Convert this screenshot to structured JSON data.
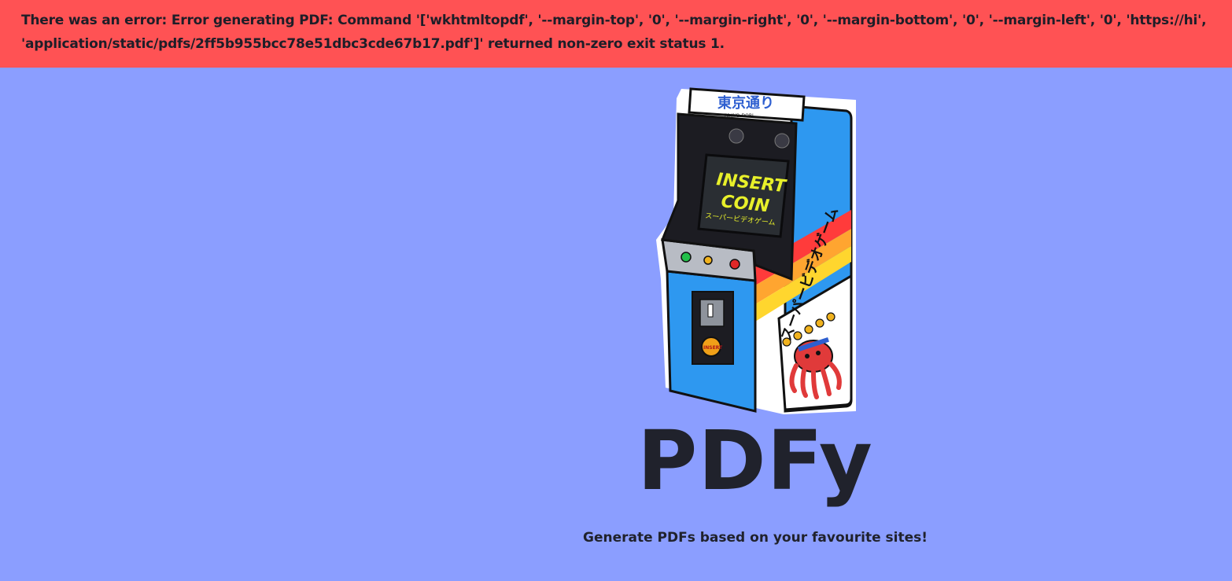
{
  "error": {
    "message": "There was an error: Error generating PDF: Command '['wkhtmltopdf', '--margin-top', '0', '--margin-right', '0', '--margin-bottom', '0', '--margin-left', '0', 'https://hi', 'application/static/pdfs/2ff5b955bcc78e51dbc3cde67b17.pdf']' returned non-zero exit status 1."
  },
  "hero": {
    "title": "PDFy",
    "tagline": "Generate PDFs based on your favourite sites!"
  },
  "arcade": {
    "marquee": "東京通り",
    "marquee_sub": "TOKYO-DORI",
    "screen_line1": "INSERT",
    "screen_line2": "COIN",
    "screen_sub": "スーパービデオゲーム",
    "side_text": "スーパービデオゲーム",
    "coin_label": "INSERT"
  },
  "colors": {
    "background": "#8b9eff",
    "error_bg": "#ff5254",
    "text": "#20222c"
  }
}
